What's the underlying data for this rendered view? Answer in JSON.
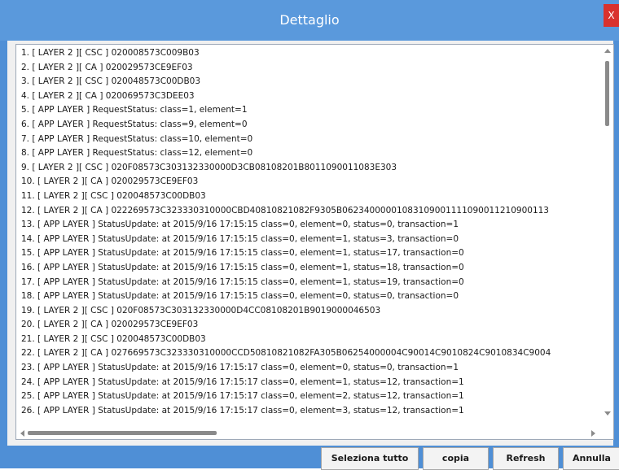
{
  "window": {
    "title": "Dettaglio",
    "close_label": "X"
  },
  "log": {
    "lines": [
      "1. [ LAYER 2 ][ CSC ] 020008573C009B03",
      "2. [ LAYER 2 ][ CA ] 020029573CE9EF03",
      "3. [ LAYER 2 ][ CSC ] 020048573C00DB03",
      "4. [ LAYER 2 ][ CA ] 020069573C3DEE03",
      "5. [ APP LAYER ] RequestStatus: class=1, element=1",
      "6. [ APP LAYER ] RequestStatus: class=9, element=0",
      "7. [ APP LAYER ] RequestStatus: class=10, element=0",
      "8. [ APP LAYER ] RequestStatus: class=12, element=0",
      "9. [ LAYER 2 ][ CSC ] 020F08573C303132330000D3CB08108201B8011090011083E303",
      "10. [ LAYER 2 ][ CA ] 020029573CE9EF03",
      "11. [ LAYER 2 ][ CSC ] 020048573C00DB03",
      "12. [ LAYER 2 ][ CA ] 022269573C323330310000CBD40810821082F9305B06234000001083109001111090011210900113",
      "13. [ APP LAYER ] StatusUpdate: at 2015/9/16 17:15:15 class=0, element=0, status=0, transaction=1",
      "14. [ APP LAYER ] StatusUpdate: at 2015/9/16 17:15:15 class=0, element=1, status=3, transaction=0",
      "15. [ APP LAYER ] StatusUpdate: at 2015/9/16 17:15:15 class=0, element=1, status=17, transaction=0",
      "16. [ APP LAYER ] StatusUpdate: at 2015/9/16 17:15:15 class=0, element=1, status=18, transaction=0",
      "17. [ APP LAYER ] StatusUpdate: at 2015/9/16 17:15:15 class=0, element=1, status=19, transaction=0",
      "18. [ APP LAYER ] StatusUpdate: at 2015/9/16 17:15:15 class=0, element=0, status=0, transaction=0",
      "19. [ LAYER 2 ][ CSC ] 020F08573C303132330000D4CC08108201B9019000046503",
      "20. [ LAYER 2 ][ CA ] 020029573CE9EF03",
      "21. [ LAYER 2 ][ CSC ] 020048573C00DB03",
      "22. [ LAYER 2 ][ CA ] 027669573C323330310000CCD50810821082FA305B06254000004C90014C9010824C9010834C9004",
      "23. [ APP LAYER ] StatusUpdate: at 2015/9/16 17:15:17 class=0, element=0, status=0, transaction=1",
      "24. [ APP LAYER ] StatusUpdate: at 2015/9/16 17:15:17 class=0, element=1, status=12, transaction=1",
      "25. [ APP LAYER ] StatusUpdate: at 2015/9/16 17:15:17 class=0, element=2, status=12, transaction=1",
      "26. [ APP LAYER ] StatusUpdate: at 2015/9/16 17:15:17 class=0, element=3, status=12, transaction=1"
    ]
  },
  "buttons": {
    "select_all": "Seleziona tutto",
    "copy": "copia",
    "refresh": "Refresh",
    "cancel": "Annulla"
  },
  "colors": {
    "titlebar": "#5a99dc",
    "close": "#d9322e"
  }
}
